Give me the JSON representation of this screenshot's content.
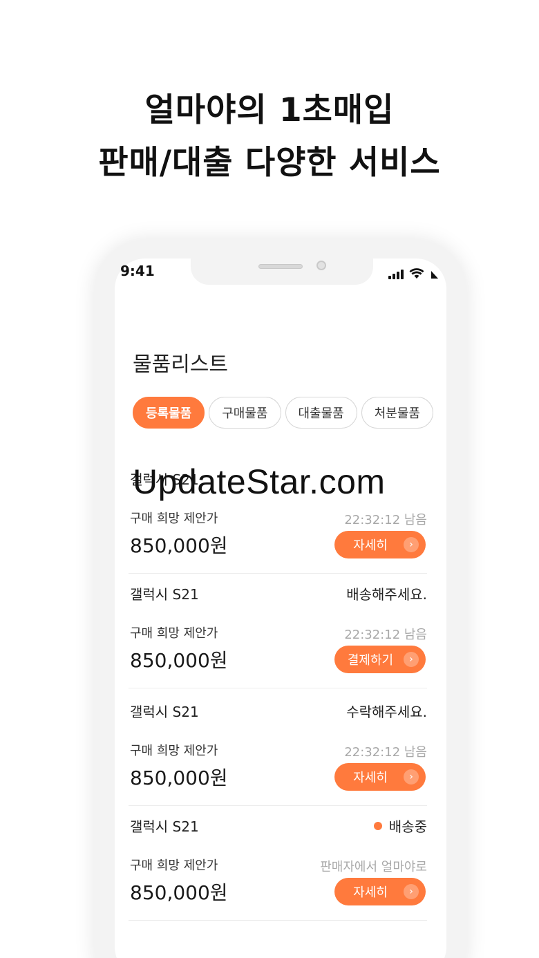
{
  "headline": {
    "line1": "얼마야의 1초매입",
    "line2": "판매/대출 다양한 서비스"
  },
  "status_bar": {
    "time": "9:41",
    "icons": [
      "signal-icon",
      "wifi-icon",
      "battery-icon"
    ]
  },
  "page": {
    "title": "물품리스트"
  },
  "tabs": [
    {
      "label": "등록물품",
      "active": true
    },
    {
      "label": "구매물품",
      "active": false
    },
    {
      "label": "대출물품",
      "active": false
    },
    {
      "label": "처분물품",
      "active": false
    }
  ],
  "items": [
    {
      "name": "갤럭시 S21",
      "status": "",
      "label": "구매 희망 제안가",
      "timer": "22:32:12 남음",
      "price": "850,000원",
      "button": "자세히"
    },
    {
      "name": "갤럭시 S21",
      "status": "배송해주세요.",
      "label": "구매 희망 제안가",
      "timer": "22:32:12 남음",
      "price": "850,000원",
      "button": "결제하기"
    },
    {
      "name": "갤럭시 S21",
      "status": "수락해주세요.",
      "label": "구매 희망 제안가",
      "timer": "22:32:12 남음",
      "price": "850,000원",
      "button": "자세히"
    },
    {
      "name": "갤럭시 S21",
      "status": "배송중",
      "label": "구매 희망 제안가",
      "timer": "판매자에서 얼마야로",
      "price": "850,000원",
      "button": "자세히"
    }
  ],
  "watermark": "UpdateStar.com",
  "colors": {
    "accent": "#ff7a3d",
    "muted_text": "#a8a8a8"
  },
  "arrow_glyph": "›"
}
